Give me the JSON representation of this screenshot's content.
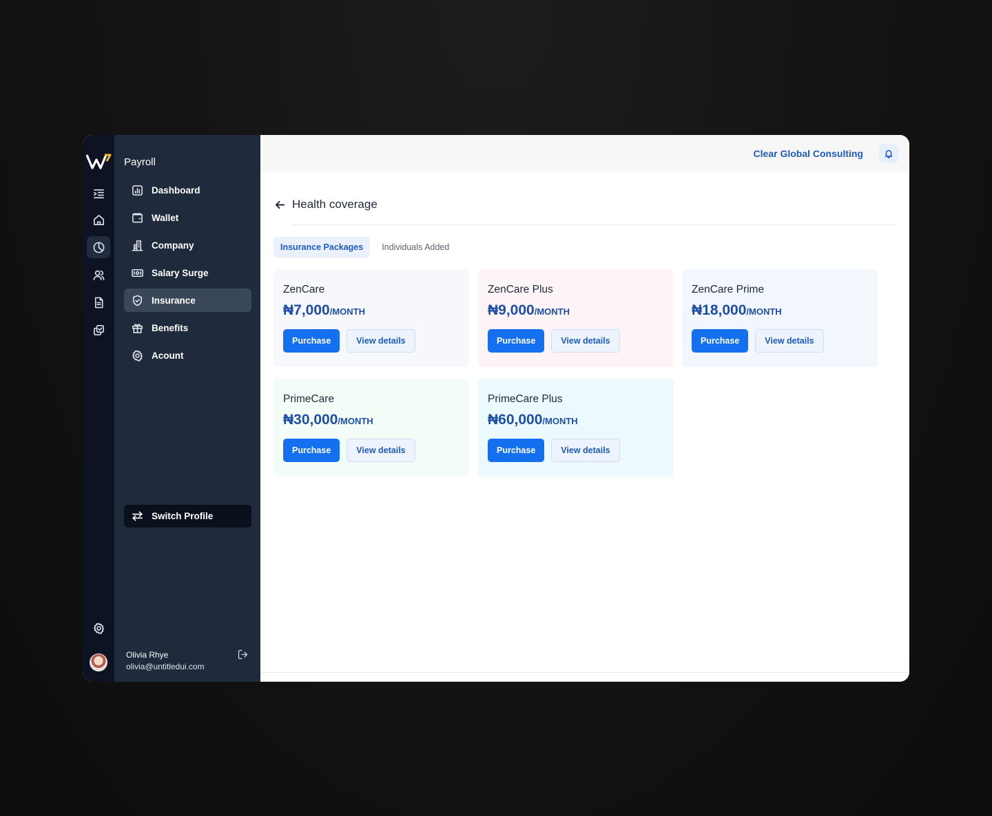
{
  "sidebar": {
    "title": "Payroll",
    "items": [
      {
        "label": "Dashboard",
        "icon": "chart-icon"
      },
      {
        "label": "Wallet",
        "icon": "wallet-icon"
      },
      {
        "label": "Company",
        "icon": "building-icon"
      },
      {
        "label": "Salary Surge",
        "icon": "banknote-icon"
      },
      {
        "label": "Insurance",
        "icon": "shield-icon",
        "active": true
      },
      {
        "label": "Benefits",
        "icon": "gift-icon"
      },
      {
        "label": "Acount",
        "icon": "gear-icon"
      }
    ],
    "switch_profile": "Switch Profile",
    "user": {
      "name": "Olivia Rhye",
      "email": "olivia@untitledui.com"
    }
  },
  "header": {
    "org_name": "Clear Global Consulting"
  },
  "page": {
    "title": "Health coverage",
    "tabs": [
      {
        "label": "Insurance Packages",
        "active": true
      },
      {
        "label": "Individuals Added",
        "active": false
      }
    ]
  },
  "packages": [
    {
      "name": "ZenCare",
      "price": "₦7,000",
      "period": "/MONTH",
      "bg": "#f6f8fb",
      "purchase": "Purchase",
      "details": "View details"
    },
    {
      "name": "ZenCare Plus",
      "price": "₦9,000",
      "period": "/MONTH",
      "bg": "#fdf4f7",
      "purchase": "Purchase",
      "details": "View details"
    },
    {
      "name": "ZenCare Prime",
      "price": "₦18,000",
      "period": "/MONTH",
      "bg": "#f2f6fd",
      "purchase": "Purchase",
      "details": "View details"
    },
    {
      "name": "PrimeCare",
      "price": "₦30,000",
      "period": "/MONTH",
      "bg": "#f3fcf7",
      "purchase": "Purchase",
      "details": "View details"
    },
    {
      "name": "PrimeCare Plus",
      "price": "₦60,000",
      "period": "/MONTH",
      "bg": "#ecfafe",
      "purchase": "Purchase",
      "details": "View details"
    }
  ],
  "colors": {
    "accent": "#1570ef",
    "brand_text": "#1f5bbf",
    "sidebar_bg": "#1f2a3c",
    "rail_bg": "#0d1322"
  }
}
